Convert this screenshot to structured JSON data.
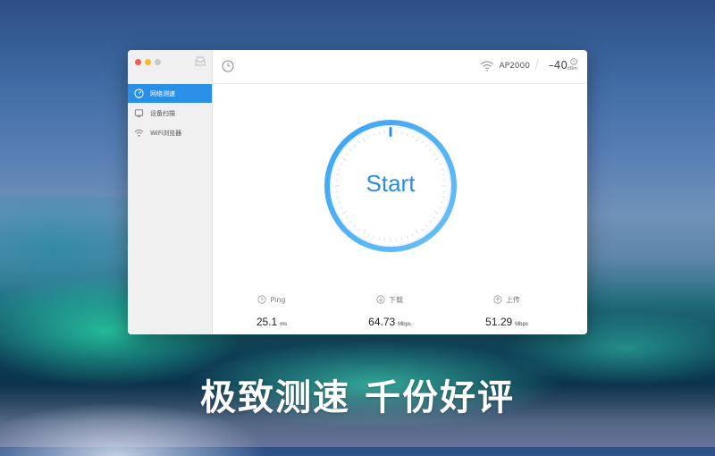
{
  "window": {
    "sidebar": {
      "items": [
        {
          "label": "网络测速",
          "icon": "speedometer-icon",
          "active": true
        },
        {
          "label": "设备扫描",
          "icon": "device-scan-icon",
          "active": false
        },
        {
          "label": "WiFi浏览器",
          "icon": "wifi-browser-icon",
          "active": false
        }
      ]
    },
    "topbar": {
      "ap_name": "AP2000",
      "rssi": "–40",
      "rssi_unit": "dBm"
    },
    "gauge": {
      "start_label": "Start"
    },
    "stats": [
      {
        "label": "Ping",
        "value": "25.1",
        "unit": "ms",
        "icon": "clock-icon"
      },
      {
        "label": "下载",
        "value": "64.73",
        "unit": "Mbps",
        "icon": "download-icon"
      },
      {
        "label": "上传",
        "value": "51.29",
        "unit": "Mbps",
        "icon": "upload-icon"
      }
    ]
  },
  "slogan": "极致测速 千份好评",
  "colors": {
    "accent": "#2a8fe6",
    "start_text": "#2b8de0"
  }
}
